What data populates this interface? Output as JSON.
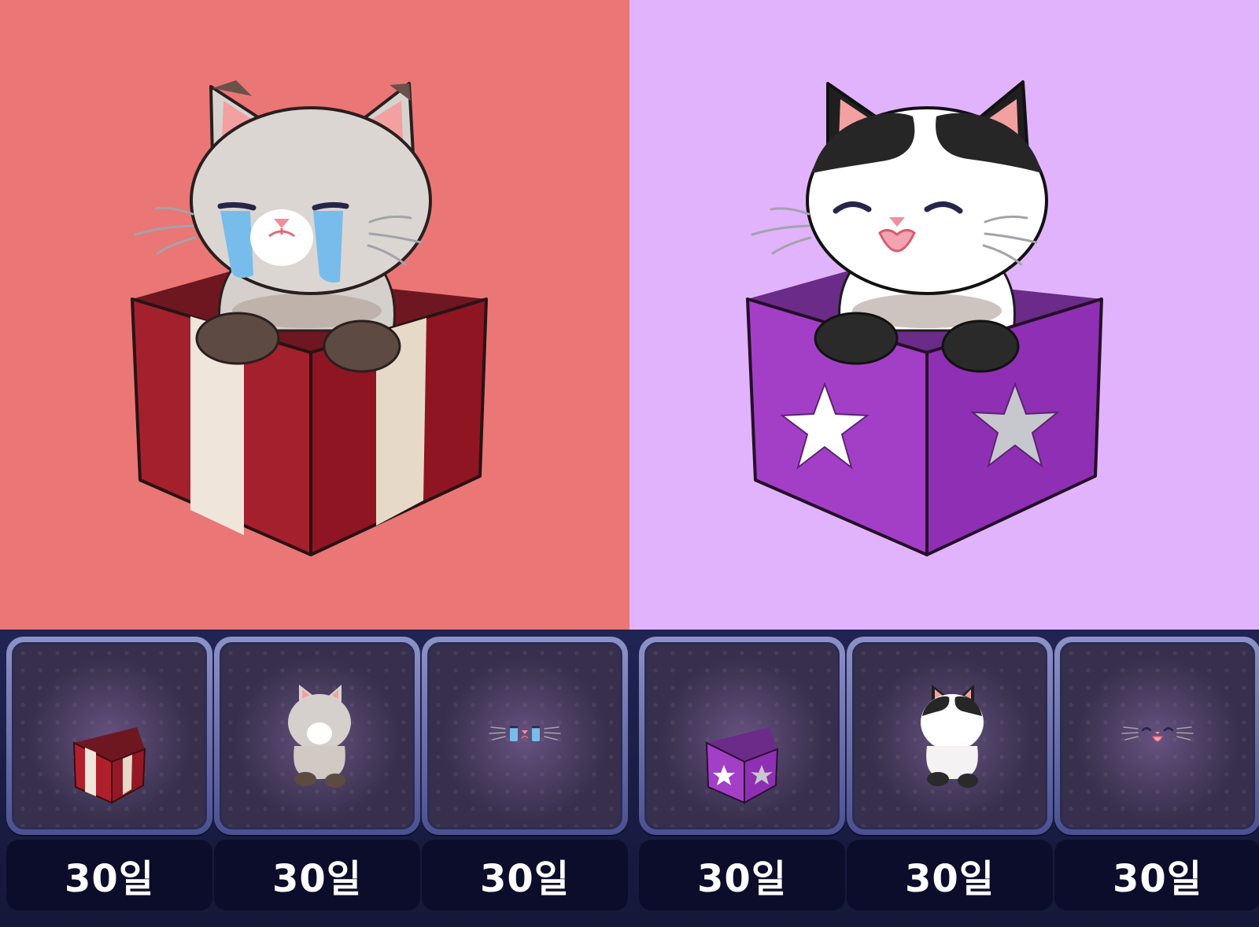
{
  "colors": {
    "left_background": "#ea7775",
    "right_background": "#e2b3fd",
    "strip_background": "#161a40",
    "tile_frame": "#6d72ad",
    "label_background": "#0b0d2a"
  },
  "preview": {
    "left": {
      "character": "gray cat crying in red striped gift box",
      "icon": "crying-gray-cat-icon"
    },
    "right": {
      "character": "black and white cat laughing in purple star box",
      "icon": "happy-tuxedo-cat-icon"
    }
  },
  "items": [
    {
      "icon": "red-gift-box-icon",
      "duration": "30일"
    },
    {
      "icon": "gray-cat-body-icon",
      "duration": "30일"
    },
    {
      "icon": "crying-face-icon",
      "duration": "30일"
    },
    {
      "icon": "purple-star-box-icon",
      "duration": "30일"
    },
    {
      "icon": "tuxedo-cat-body-icon",
      "duration": "30일"
    },
    {
      "icon": "laughing-face-icon",
      "duration": "30일"
    }
  ]
}
